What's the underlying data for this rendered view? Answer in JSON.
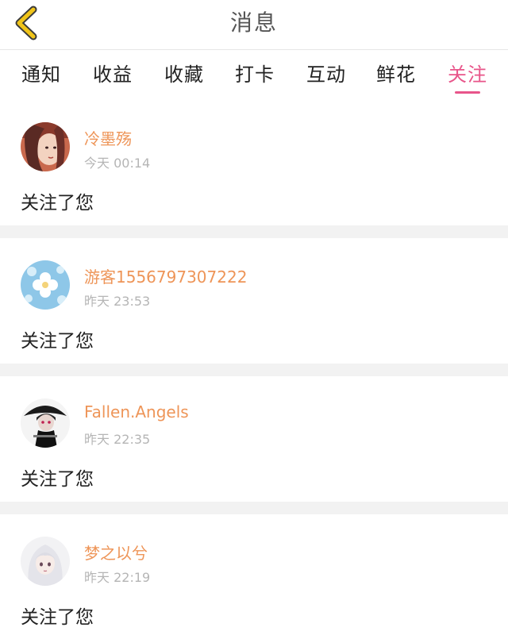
{
  "header": {
    "title": "消息",
    "back_icon": "chevron-left-icon",
    "back_icon_color": "#f0c419"
  },
  "tabs": [
    {
      "label": "通知",
      "active": false
    },
    {
      "label": "收益",
      "active": false
    },
    {
      "label": "收藏",
      "active": false
    },
    {
      "label": "打卡",
      "active": false
    },
    {
      "label": "互动",
      "active": false
    },
    {
      "label": "鲜花",
      "active": false
    },
    {
      "label": "关注",
      "active": true
    }
  ],
  "colors": {
    "accent": "#e8558a",
    "username": "#ee9558",
    "timestamp": "#b5b5b5",
    "separator": "#f2f2f2"
  },
  "messages": [
    {
      "username": "冷墨殇",
      "time": "今天 00:14",
      "text": "关注了您",
      "avatar_icon": "avatar-girl-red"
    },
    {
      "username": "游客1556797307222",
      "time": "昨天 23:53",
      "text": "关注了您",
      "avatar_icon": "avatar-blue-flower"
    },
    {
      "username": "Fallen.Angels",
      "time": "昨天 22:35",
      "text": "关注了您",
      "avatar_icon": "avatar-dark-figure"
    },
    {
      "username": "梦之以兮",
      "time": "昨天 22:19",
      "text": "关注了您",
      "avatar_icon": "avatar-white-hair-girl"
    }
  ]
}
